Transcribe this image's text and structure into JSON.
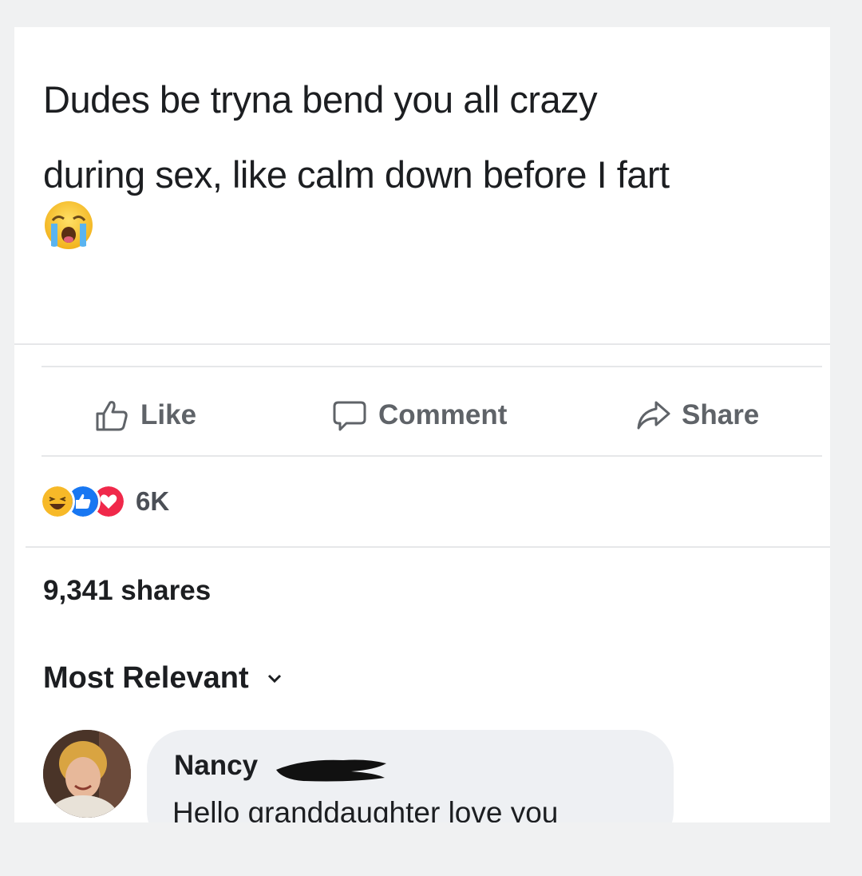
{
  "post": {
    "text": "Dudes be tryna bend you all crazy\nduring sex, like calm down before I fart",
    "emoji_icon": "loudly-crying-face-icon"
  },
  "actions": {
    "like_label": "Like",
    "comment_label": "Comment",
    "share_label": "Share"
  },
  "reactions": {
    "icons": [
      "laughing-face-icon",
      "thumbs-up-icon",
      "heart-icon"
    ],
    "count": "6K"
  },
  "shares": {
    "label": "9,341 shares"
  },
  "comments": {
    "sort_label": "Most Relevant",
    "items": [
      {
        "author": "Nancy",
        "text": "Hello granddaughter love you"
      }
    ]
  },
  "colors": {
    "like_blue": "#1877f2",
    "heart_red": "#f0284a",
    "haha_yellow": "#f7b928"
  }
}
